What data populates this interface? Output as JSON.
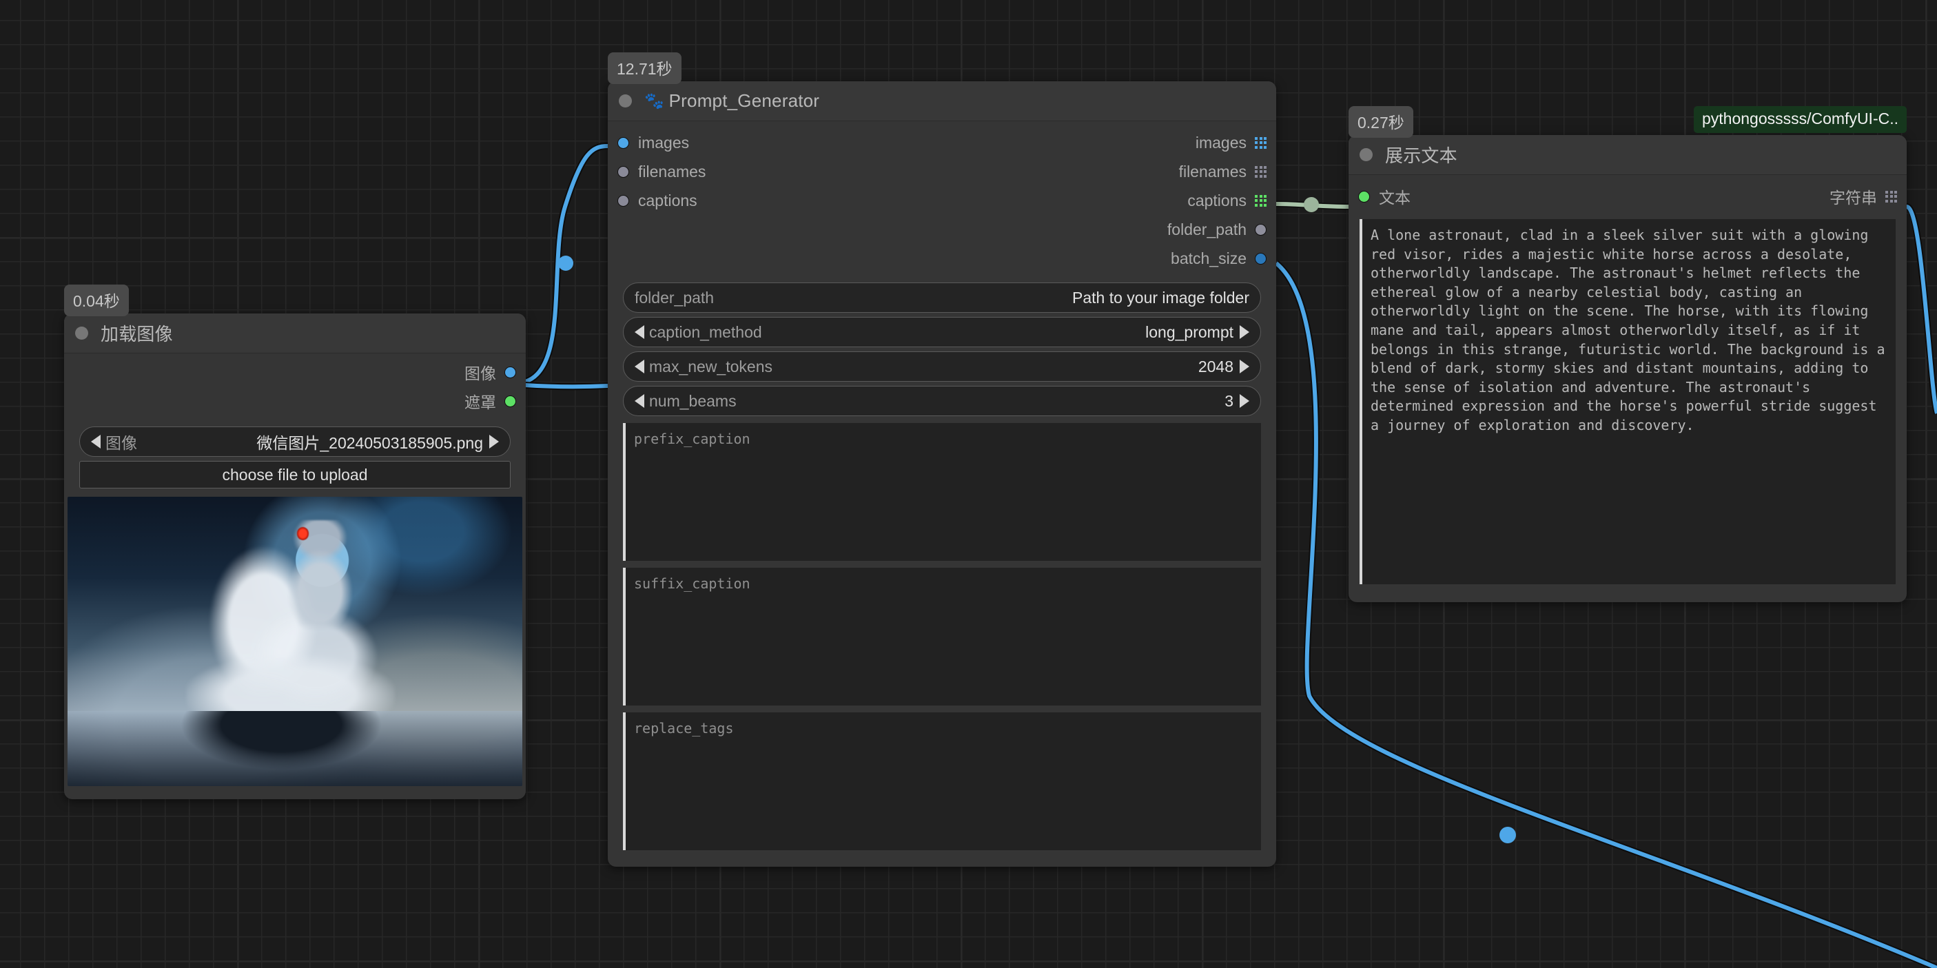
{
  "canvas": {
    "background_color": "#1b1b1b",
    "grid_color": "#272727"
  },
  "nodes": {
    "load_image": {
      "time_badge": "0.04秒",
      "title": "加载图像",
      "outputs": [
        {
          "label": "图像",
          "dot": "blue"
        },
        {
          "label": "遮罩",
          "dot": "green"
        }
      ],
      "widgets": {
        "image": {
          "name": "图像",
          "value": "微信图片_20240503185905.png"
        },
        "upload_button": "choose file to upload"
      },
      "preview_alt": "astronaut on white horse under blue moon"
    },
    "prompt_generator": {
      "time_badge": "12.71秒",
      "title": "Prompt_Generator",
      "title_icon": "paw-prints",
      "inputs": [
        {
          "label": "images",
          "dot": "blue"
        },
        {
          "label": "filenames",
          "dot": "gray"
        },
        {
          "label": "captions",
          "dot": "gray"
        }
      ],
      "outputs": [
        {
          "label": "images",
          "icon": "grid",
          "color": "blue"
        },
        {
          "label": "filenames",
          "icon": "grid",
          "color": "gray"
        },
        {
          "label": "captions",
          "icon": "grid",
          "color": "green"
        },
        {
          "label": "folder_path",
          "icon": "dot",
          "color": "hollow"
        },
        {
          "label": "batch_size",
          "icon": "dot",
          "color": "dblue"
        }
      ],
      "widgets": [
        {
          "name": "folder_path",
          "value": "Path to your image folder",
          "stepper": false
        },
        {
          "name": "caption_method",
          "value": "long_prompt",
          "stepper": true
        },
        {
          "name": "max_new_tokens",
          "value": "2048",
          "stepper": true
        },
        {
          "name": "num_beams",
          "value": "3",
          "stepper": true
        }
      ],
      "textareas": [
        {
          "placeholder": "prefix_caption",
          "value": ""
        },
        {
          "placeholder": "suffix_caption",
          "value": ""
        },
        {
          "placeholder": "replace_tags",
          "value": ""
        }
      ]
    },
    "show_text": {
      "time_badge": "0.27秒",
      "source_badge": "pythongosssss/ComfyUI-C..",
      "title": "展示文本",
      "input": {
        "label": "文本",
        "dot": "green"
      },
      "output": {
        "label": "字符串",
        "icon": "grid",
        "color": "gray"
      },
      "text_value": "A lone astronaut, clad in a sleek silver suit with a glowing red visor, rides a majestic white horse across a desolate, otherworldly landscape. The astronaut's helmet reflects the ethereal glow of a nearby celestial body, casting an otherworldly light on the scene. The horse, with its flowing mane and tail, appears almost otherworldly itself, as if it belongs in this strange, futuristic world. The background is a blend of dark, stormy skies and distant mountains, adding to the sense of isolation and adventure. The astronaut's determined expression and the horse's powerful stride suggest a journey of exploration and discovery."
    }
  },
  "links": [
    {
      "from": "load_image.图像",
      "to": "prompt_generator.images",
      "color": "#4ea7e8"
    },
    {
      "from": "prompt_generator.captions",
      "to": "show_text.文本",
      "color": "#a9c4a9"
    },
    {
      "from": "prompt_generator.batch_size",
      "to": "offscreen",
      "color": "#4ea7e8"
    },
    {
      "from": "show_text.字符串",
      "to": "offscreen",
      "color": "#4ea7e8"
    }
  ]
}
